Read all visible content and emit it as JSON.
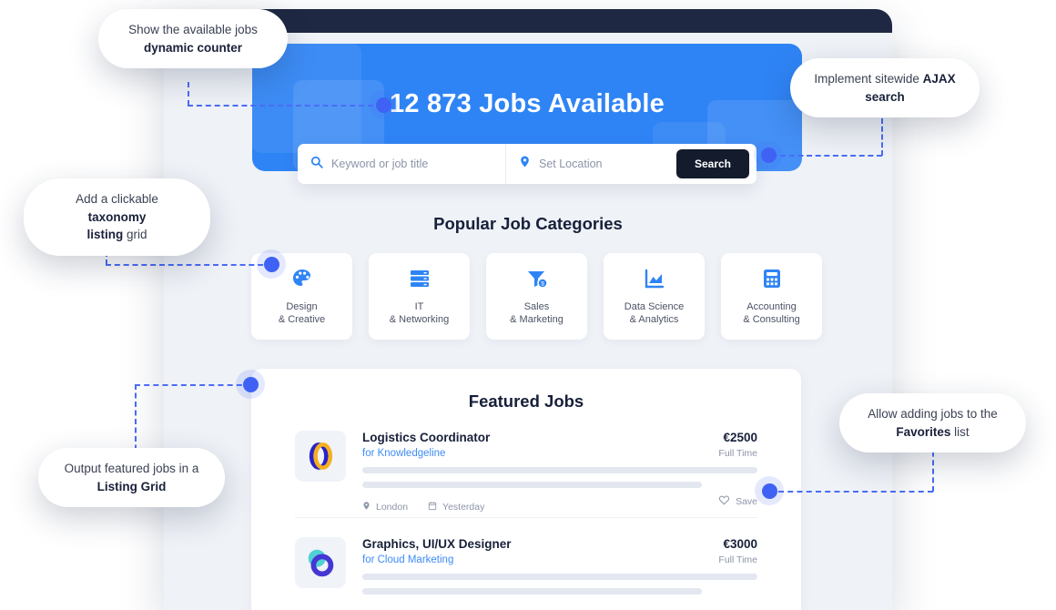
{
  "window": {
    "nav_placeholders": [
      "",
      "",
      "",
      ""
    ]
  },
  "hero": {
    "title": "12 873 Jobs Available",
    "search": {
      "keyword_placeholder": "Keyword or job title",
      "location_placeholder": "Set Location",
      "button_label": "Search"
    }
  },
  "categories": {
    "title": "Popular Job Categories",
    "items": [
      {
        "icon": "palette-icon",
        "line1": "Design",
        "line2": "& Creative"
      },
      {
        "icon": "server-icon",
        "line1": "IT",
        "line2": "& Networking"
      },
      {
        "icon": "funnel-coin-icon",
        "line1": "Sales",
        "line2": "& Marketing"
      },
      {
        "icon": "chart-icon",
        "line1": "Data Science",
        "line2": "& Analytics"
      },
      {
        "icon": "calculator-icon",
        "line1": "Accounting",
        "line2": "& Consulting"
      }
    ]
  },
  "featured": {
    "title": "Featured Jobs",
    "jobs": [
      {
        "title": "Logistics Coordinator",
        "company": "for Knowledgeline",
        "salary": "€2500",
        "type": "Full Time",
        "location": "London",
        "date": "Yesterday",
        "save_label": "Save"
      },
      {
        "title": "Graphics, UI/UX Designer",
        "company": "for Cloud Marketing",
        "salary": "€3000",
        "type": "Full Time"
      }
    ]
  },
  "callouts": [
    {
      "id": "counter",
      "line1": "Show the available jobs",
      "line2_bold": "dynamic counter",
      "line2_tail": ""
    },
    {
      "id": "ajax",
      "line1": "Implement sitewide ",
      "line1_bold": "AJAX",
      "line2_bold": "search",
      "line2_tail": ""
    },
    {
      "id": "taxonomy",
      "line1": "Add a clickable ",
      "line1_bold": "taxonomy",
      "line2_bold": "listing",
      "line2_tail": " grid"
    },
    {
      "id": "listing",
      "line1": "Output featured jobs in a",
      "line2_bold": "Listing Grid",
      "line2_tail": ""
    },
    {
      "id": "favorites",
      "line1": "Allow adding jobs to the",
      "line2_bold": "Favorites",
      "line2_tail": " list"
    }
  ],
  "colors": {
    "accent_blue": "#2f84f5",
    "dot_blue": "#3f62f4",
    "dark_navy": "#1e2842",
    "page_bg": "#eff2f7"
  }
}
